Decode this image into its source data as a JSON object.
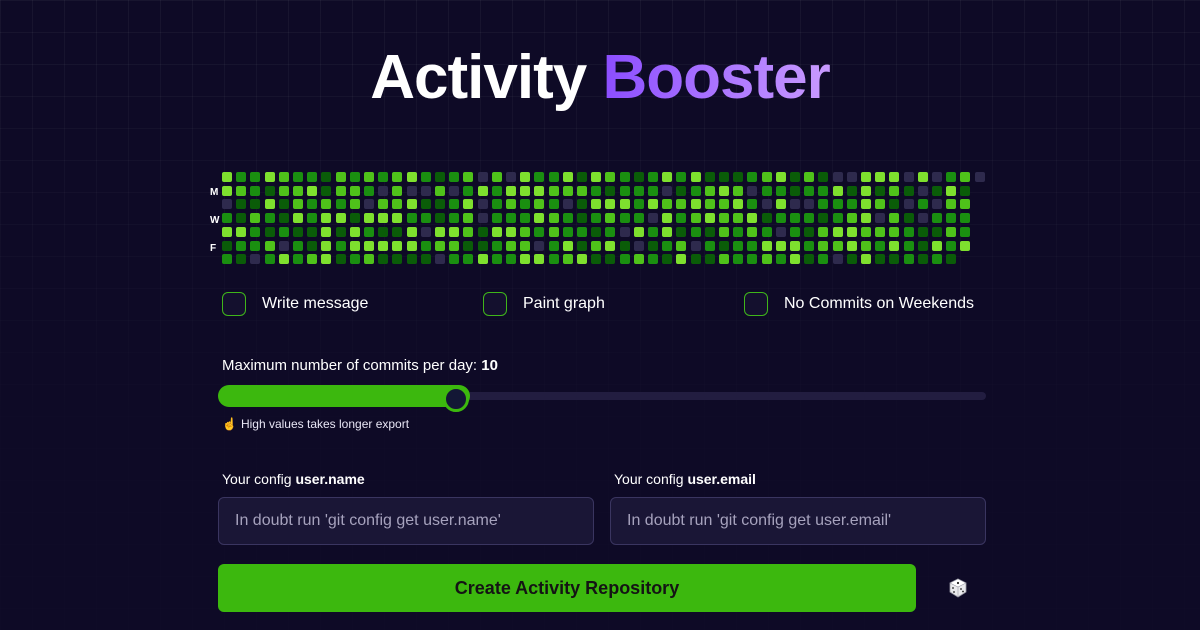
{
  "title": {
    "part1": "Activity",
    "part2": "Booster"
  },
  "heatmap": {
    "day_labels": [
      "M",
      "W",
      "F"
    ],
    "palette": [
      "#2e2a4d",
      "#0a5c08",
      "#1a8f10",
      "#4fc21a",
      "#7ee02e"
    ],
    "weeks": 54,
    "days": 7
  },
  "options": [
    {
      "label": "Write message",
      "checked": false
    },
    {
      "label": "Paint graph",
      "checked": false
    },
    {
      "label": "No Commits on Weekends",
      "checked": false
    }
  ],
  "slider": {
    "label": "Maximum number of commits per day:",
    "value": "10",
    "fraction": 0.31
  },
  "hint": {
    "emoji": "☝️",
    "text": "High values takes longer export"
  },
  "config": {
    "name": {
      "label_prefix": "Your config",
      "label_key": "user.name",
      "placeholder": "In doubt run 'git config get user.name'"
    },
    "email": {
      "label_prefix": "Your config",
      "label_key": "user.email",
      "placeholder": "In doubt run 'git config get user.email'"
    }
  },
  "create_button": {
    "label": "Create Activity Repository"
  },
  "dice_icon": "dice-icon"
}
